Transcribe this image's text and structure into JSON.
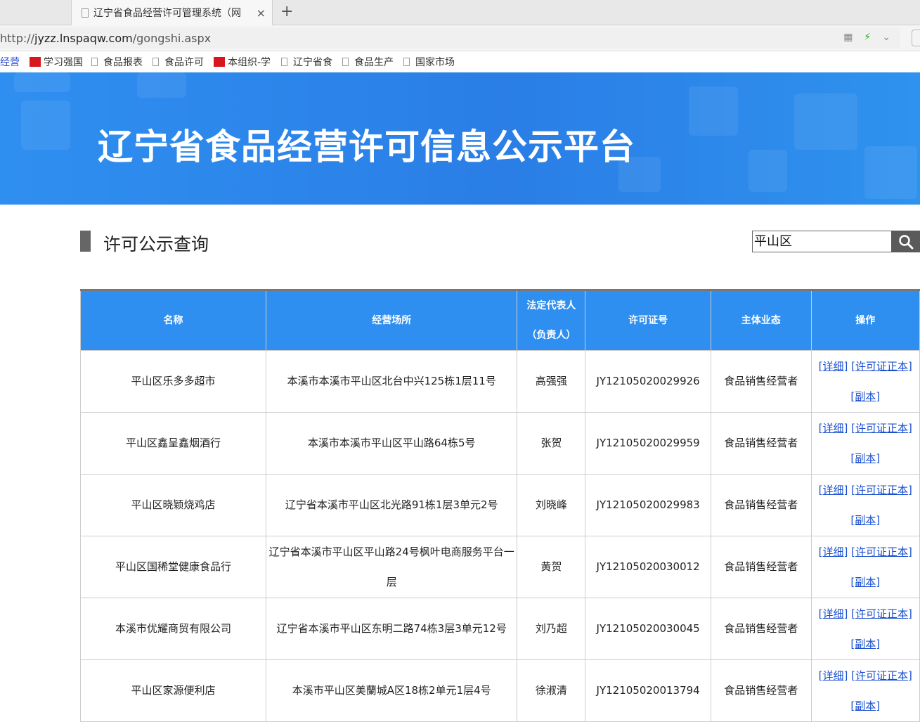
{
  "browser": {
    "tab_title": "辽宁省食品经营许可管理系统（网",
    "tab_close": "×",
    "new_tab": "+",
    "url_prefix": "http://",
    "url_host": "jyzz.lnspaqw.com",
    "url_path": "/gongshi.aspx",
    "bookmarks": [
      "经营",
      "学习强国",
      "食品报表",
      "食品许可",
      "本组织-学",
      "辽宁省食",
      "食品生产",
      "国家市场"
    ]
  },
  "banner": {
    "title": "辽宁省食品经营许可信息公示平台"
  },
  "section": {
    "title": "许可公示查询"
  },
  "search": {
    "value": "平山区"
  },
  "table": {
    "headers": {
      "name": "名称",
      "place": "经营场所",
      "rep_line1": "法定代表人",
      "rep_line2": "（负责人）",
      "license": "许可证号",
      "type": "主体业态",
      "ops": "操作"
    },
    "link_detail": "[详细]",
    "link_original": "[许可证正本]",
    "link_copy": "[副本]",
    "rows": [
      {
        "name": "平山区乐多多超市",
        "place": "本溪市本溪市平山区北台中兴125栋1层11号",
        "rep": "高强强",
        "license": "JY12105020029926",
        "type": "食品销售经营者"
      },
      {
        "name": "平山区鑫呈鑫烟酒行",
        "place": "本溪市本溪市平山区平山路64栋5号",
        "rep": "张贺",
        "license": "JY12105020029959",
        "type": "食品销售经营者"
      },
      {
        "name": "平山区晓颖烧鸡店",
        "place": "辽宁省本溪市平山区北光路91栋1层3单元2号",
        "rep": "刘晓峰",
        "license": "JY12105020029983",
        "type": "食品销售经营者"
      },
      {
        "name": "平山区国稀堂健康食品行",
        "place": "辽宁省本溪市平山区平山路24号枫叶电商服务平台一层",
        "rep": "黄贺",
        "license": "JY12105020030012",
        "type": "食品销售经营者"
      },
      {
        "name": "本溪市优耀商贸有限公司",
        "place": "辽宁省本溪市平山区东明二路74栋3层3单元12号",
        "rep": "刘乃超",
        "license": "JY12105020030045",
        "type": "食品销售经营者"
      },
      {
        "name": "平山区家源便利店",
        "place": "本溪市平山区美蘭城A区18栋2单元1层4号",
        "rep": "徐淑清",
        "license": "JY12105020013794",
        "type": "食品销售经营者"
      }
    ]
  }
}
